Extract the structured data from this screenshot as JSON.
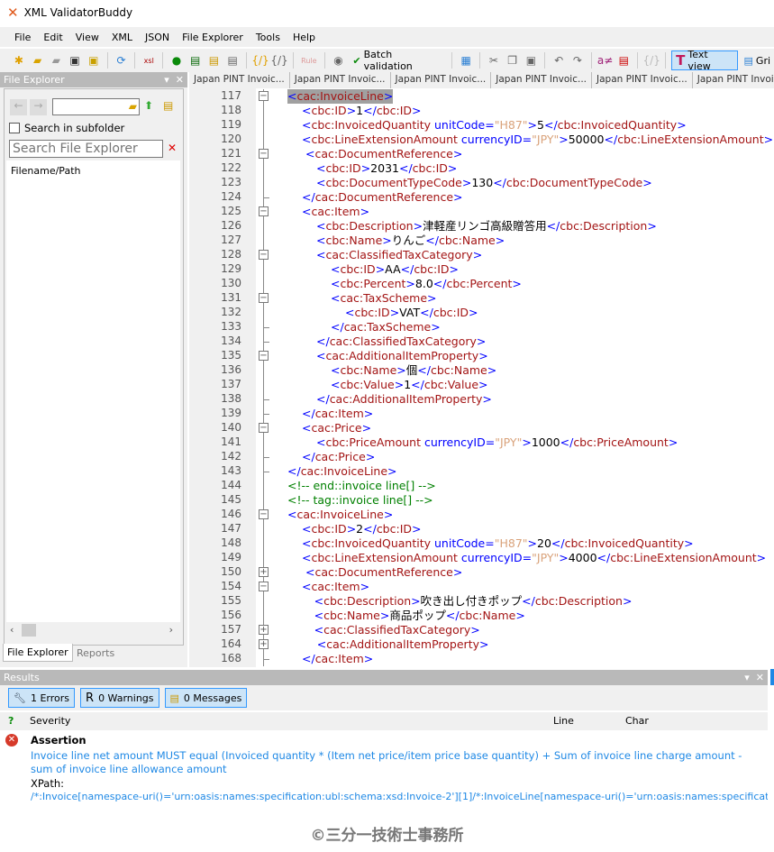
{
  "app": {
    "title": "XML ValidatorBuddy"
  },
  "menu": [
    "File",
    "Edit",
    "View",
    "XML",
    "JSON",
    "File Explorer",
    "Tools",
    "Help"
  ],
  "toolbar": {
    "batch_validation": "Batch validation",
    "rule": "Rule",
    "text_view": "Text view",
    "grid_view": "Gri"
  },
  "file_explorer": {
    "title": "File Explorer",
    "search_subfolder": "Search in subfolder",
    "search_placeholder": "Search File Explorer",
    "column": "Filename/Path",
    "tabs": [
      "File Explorer",
      "Reports"
    ]
  },
  "editor": {
    "tabs": [
      "Japan PINT Invoic...",
      "Japan PINT Invoic...",
      "Japan PINT Invoic...",
      "Japan PINT Invoic...",
      "Japan PINT Invoic...",
      "Japan PINT Invoic...",
      "J"
    ],
    "lines": [
      {
        "n": 117,
        "i": 0,
        "f": "minus",
        "t": "<cac:InvoiceLine>",
        "hl": true
      },
      {
        "n": 118,
        "i": 1,
        "f": "",
        "t": "<cbc:ID>1</cbc:ID>"
      },
      {
        "n": 119,
        "i": 1,
        "f": "",
        "t": "<cbc:InvoicedQuantity unitCode=\"H87\">5</cbc:InvoicedQuantity>"
      },
      {
        "n": 120,
        "i": 1,
        "f": "",
        "t": "<cbc:LineExtensionAmount currencyID=\"JPY\">50000</cbc:LineExtensionAmount>"
      },
      {
        "n": 121,
        "i": 1.25,
        "f": "minus",
        "t": "<cac:DocumentReference>"
      },
      {
        "n": 122,
        "i": 2,
        "f": "",
        "t": "<cbc:ID>2031</cbc:ID>"
      },
      {
        "n": 123,
        "i": 2,
        "f": "",
        "t": "<cbc:DocumentTypeCode>130</cbc:DocumentTypeCode>"
      },
      {
        "n": 124,
        "i": 1,
        "f": "end",
        "t": "</cac:DocumentReference>"
      },
      {
        "n": 125,
        "i": 1,
        "f": "minus",
        "t": "<cac:Item>"
      },
      {
        "n": 126,
        "i": 2,
        "f": "",
        "t": "<cbc:Description>津軽産リンゴ高級贈答用</cbc:Description>"
      },
      {
        "n": 127,
        "i": 2,
        "f": "",
        "t": "<cbc:Name>りんご</cbc:Name>"
      },
      {
        "n": 128,
        "i": 2,
        "f": "minus",
        "t": "<cac:ClassifiedTaxCategory>"
      },
      {
        "n": 129,
        "i": 3,
        "f": "",
        "t": "<cbc:ID>AA</cbc:ID>"
      },
      {
        "n": 130,
        "i": 3,
        "f": "",
        "t": "<cbc:Percent>8.0</cbc:Percent>"
      },
      {
        "n": 131,
        "i": 3,
        "f": "minus",
        "t": "<cac:TaxScheme>"
      },
      {
        "n": 132,
        "i": 4,
        "f": "",
        "t": "<cbc:ID>VAT</cbc:ID>"
      },
      {
        "n": 133,
        "i": 3,
        "f": "end",
        "t": "</cac:TaxScheme>"
      },
      {
        "n": 134,
        "i": 2,
        "f": "end",
        "t": "</cac:ClassifiedTaxCategory>"
      },
      {
        "n": 135,
        "i": 2,
        "f": "minus",
        "t": "<cac:AdditionalItemProperty>"
      },
      {
        "n": 136,
        "i": 3,
        "f": "",
        "t": "<cbc:Name>個</cbc:Name>"
      },
      {
        "n": 137,
        "i": 3,
        "f": "",
        "t": "<cbc:Value>1</cbc:Value>"
      },
      {
        "n": 138,
        "i": 2,
        "f": "end",
        "t": "</cac:AdditionalItemProperty>"
      },
      {
        "n": 139,
        "i": 1,
        "f": "end",
        "t": "</cac:Item>"
      },
      {
        "n": 140,
        "i": 1,
        "f": "minus",
        "t": "<cac:Price>"
      },
      {
        "n": 141,
        "i": 2,
        "f": "",
        "t": "<cbc:PriceAmount currencyID=\"JPY\">1000</cbc:PriceAmount>"
      },
      {
        "n": 142,
        "i": 1,
        "f": "end",
        "t": "</cac:Price>"
      },
      {
        "n": 143,
        "i": 0,
        "f": "end",
        "t": "</cac:InvoiceLine>"
      },
      {
        "n": 144,
        "i": 0,
        "f": "",
        "t": "<!-- end::invoice line[] -->"
      },
      {
        "n": 145,
        "i": 0,
        "f": "",
        "t": "<!-- tag::invoice line[] -->"
      },
      {
        "n": 146,
        "i": 0,
        "f": "minus",
        "t": "<cac:InvoiceLine>"
      },
      {
        "n": 147,
        "i": 1,
        "f": "",
        "t": "<cbc:ID>2</cbc:ID>"
      },
      {
        "n": 148,
        "i": 1,
        "f": "",
        "t": "<cbc:InvoicedQuantity unitCode=\"H87\">20</cbc:InvoicedQuantity>"
      },
      {
        "n": 149,
        "i": 1,
        "f": "",
        "t": "<cbc:LineExtensionAmount currencyID=\"JPY\">4000</cbc:LineExtensionAmount>"
      },
      {
        "n": 150,
        "i": 1.25,
        "f": "plus",
        "t": "<cac:DocumentReference>"
      },
      {
        "n": 154,
        "i": 1,
        "f": "minus",
        "t": "<cac:Item>"
      },
      {
        "n": 155,
        "i": 1.85,
        "f": "",
        "t": "<cbc:Description>吹き出し付きポップ</cbc:Description>"
      },
      {
        "n": 156,
        "i": 1.85,
        "f": "",
        "t": "<cbc:Name>商品ポップ</cbc:Name>"
      },
      {
        "n": 157,
        "i": 1.85,
        "f": "plus",
        "t": "<cac:ClassifiedTaxCategory>"
      },
      {
        "n": 164,
        "i": 2.05,
        "f": "plus",
        "t": "<cac:AdditionalItemProperty>"
      },
      {
        "n": 168,
        "i": 1,
        "f": "end",
        "t": "</cac:Item>"
      }
    ]
  },
  "results": {
    "title": "Results",
    "errors": "1 Errors",
    "warnings": "0 Warnings",
    "messages": "0 Messages",
    "columns": {
      "q": "?",
      "severity": "Severity",
      "line": "Line",
      "char": "Char"
    },
    "item": {
      "type": "Assertion",
      "message": "Invoice line net amount MUST equal (Invoiced quantity * (Item net price/item price base quantity) + Sum of invoice line charge amount - sum of invoice line allowance amount",
      "xpath_label": "XPath:",
      "xpath": "/*:Invoice[namespace-uri()='urn:oasis:names:specification:ubl:schema:xsd:Invoice-2'][1]/*:InvoiceLine[namespace-uri()='urn:oasis:names:specification:ubl"
    }
  },
  "watermark": "©三分一技術士事務所",
  "colors": {
    "tag": "#a31515",
    "bracket": "#0000ff",
    "attr_value": "#d9a27a",
    "comment": "#008000",
    "accent": "#3399ff",
    "message": "#1e88e5"
  }
}
